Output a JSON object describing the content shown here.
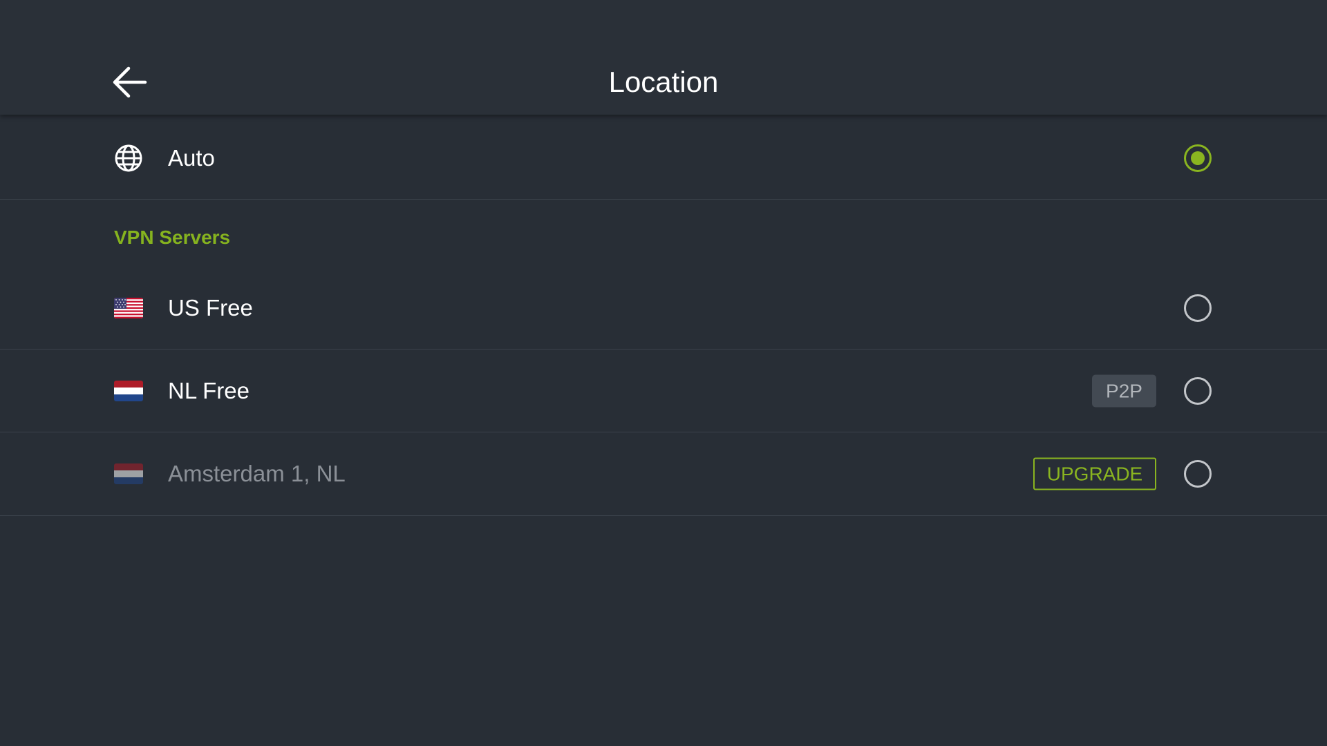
{
  "header": {
    "title": "Location",
    "back_icon": "arrow-left-icon"
  },
  "auto_option": {
    "icon": "globe-icon",
    "label": "Auto",
    "selected": true
  },
  "servers_section": {
    "title": "VPN Servers",
    "servers": [
      {
        "label": "US Free",
        "flag": "us-flag-icon",
        "badge": null,
        "selected": false,
        "locked": false
      },
      {
        "label": "NL Free",
        "flag": "nl-flag-icon",
        "badge": "P2P",
        "selected": false,
        "locked": false
      },
      {
        "label": "Amsterdam 1, NL",
        "flag": "nl-flag-icon",
        "badge": "UPGRADE",
        "selected": false,
        "locked": true
      }
    ]
  },
  "colors": {
    "background": "#282e36",
    "accent": "#8ab520",
    "divider": "#3b424b",
    "badge_bg": "#434a53"
  }
}
